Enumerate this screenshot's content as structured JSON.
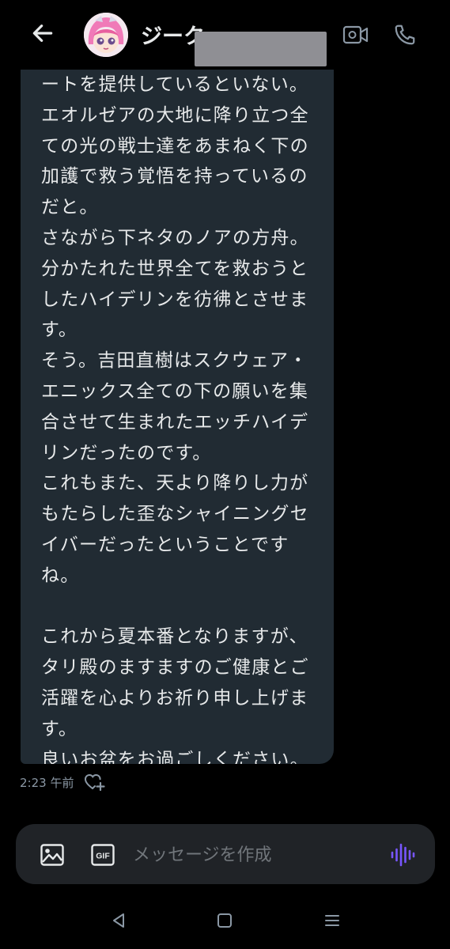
{
  "header": {
    "name": "ジーク",
    "icons": {
      "back": "arrow-left-icon",
      "video": "video-camera-icon",
      "phone": "phone-icon"
    }
  },
  "message": {
    "text": "ートを提供しているといない。\nエオルゼアの大地に降り立つ全ての光の戦士達をあまねく下の加護で救う覚悟を持っているのだと。\nさながら下ネタのノアの方舟。\n分かたれた世界全てを救おうとしたハイデリンを彷彿とさせます。\nそう。吉田直樹はスクウェア・エニックス全ての下の願いを集合させて生まれたエッチハイデリンだったのです。\nこれもまた、天より降りし力がもたらした歪なシャイニングセイバーだったということですね。\n\nこれから夏本番となりますが、タリ殿のますますのご健康とご活躍を心よりお祈り申し上げます。\n良いお盆をお過ごしください。",
    "time": "2:23 午前",
    "reaction_icon": "heart-plus-icon"
  },
  "composer": {
    "placeholder": "メッセージを作成",
    "gif_label": "GIF",
    "icons": {
      "image": "image-icon",
      "gif": "gif-icon",
      "voice": "voice-waveform-icon"
    }
  },
  "navbar": {
    "icons": [
      "nav-back-icon",
      "nav-home-icon",
      "nav-recent-icon"
    ]
  },
  "colors": {
    "accent": "#7856ff",
    "bubble": "#212b33",
    "background": "#000000",
    "text": "#e7e9ea",
    "muted": "#8b98a5"
  }
}
